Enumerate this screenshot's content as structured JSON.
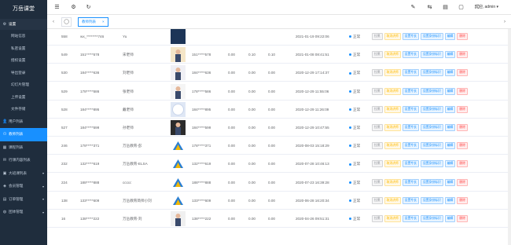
{
  "app": {
    "title": "万岳课堂"
  },
  "sidebar": {
    "settings_group": "设置",
    "settings_items": [
      "网站信息",
      "私密设置",
      "授权设置",
      "导出登录",
      "幻灯片管理",
      "上传设置",
      "文件存储"
    ],
    "menu_items": [
      {
        "label": "用户列表",
        "active": false
      },
      {
        "label": "教师列表",
        "active": true
      },
      {
        "label": "课程列表",
        "active": false
      },
      {
        "label": "行课内容列表",
        "active": false
      },
      {
        "label": "大班课列表",
        "active": false
      },
      {
        "label": "会员管理",
        "active": false
      },
      {
        "label": "订单管理",
        "active": false
      },
      {
        "label": "团体管理",
        "active": false
      }
    ]
  },
  "topbar": {
    "user_label": "欢迎, admin ▾"
  },
  "tabs": [
    {
      "label": "教师列表",
      "close": "×"
    }
  ],
  "tabs_nav": {
    "left_arrow": "‹",
    "right_arrow": "›",
    "home": "◯"
  },
  "table": {
    "rows": [
      {
        "id": "558",
        "mobile": "wx_********746",
        "name": "Yu",
        "account": "",
        "c1": "",
        "c2": "",
        "c3": "",
        "time": "2021-01-19 09:22:06",
        "status": "正常"
      },
      {
        "id": "549",
        "mobile": "151*****578",
        "name": "宋老师",
        "account": "151*****578",
        "c1": "0.00",
        "c2": "0.10",
        "c3": "0.10",
        "time": "2021-01-08 08:41:51",
        "status": "正常"
      },
      {
        "id": "530",
        "mobile": "184*****636",
        "name": "刘老师",
        "account": "184*****636",
        "c1": "0.00",
        "c2": "0.00",
        "c3": "0.00",
        "time": "2020-12-29 17:14:37",
        "status": "正常"
      },
      {
        "id": "529",
        "mobile": "178*****586",
        "name": "张老师",
        "account": "178*****586",
        "c1": "0.00",
        "c2": "0.00",
        "c3": "0.00",
        "time": "2020-12-29 11:55:06",
        "status": "正常"
      },
      {
        "id": "528",
        "mobile": "184*****895",
        "name": "戴老师",
        "account": "184*****895",
        "c1": "0.00",
        "c2": "0.00",
        "c3": "0.00",
        "time": "2020-12-29 11:26:09",
        "status": "正常"
      },
      {
        "id": "527",
        "mobile": "184*****599",
        "name": "孙老师",
        "account": "184*****599",
        "c1": "0.00",
        "c2": "0.00",
        "c3": "0.00",
        "time": "2020-12-29 10:47:55",
        "status": "正常"
      },
      {
        "id": "246",
        "mobile": "178*****371",
        "name": "万岳教育-彭",
        "account": "178*****371",
        "c1": "0.00",
        "c2": "0.00",
        "c3": "0.00",
        "time": "2020-08-03 15:18:29",
        "status": "正常"
      },
      {
        "id": "232",
        "mobile": "132*****619",
        "name": "万岳教育-ELSA",
        "account": "132*****619",
        "c1": "0.00",
        "c2": "0.00",
        "c3": "0.00",
        "time": "2020-07-28 10:46:13",
        "status": "正常"
      },
      {
        "id": "224",
        "mobile": "188*****888",
        "name": "ccccc",
        "account": "188*****888",
        "c1": "0.00",
        "c2": "0.00",
        "c3": "0.00",
        "time": "2020-07-23 16:39:28",
        "status": "正常"
      },
      {
        "id": "138",
        "mobile": "133*****609",
        "name": "万岳教育简师小刘",
        "account": "133*****609",
        "c1": "0.00",
        "c2": "0.00",
        "c3": "0.00",
        "time": "2020-06-28 16:20:34",
        "status": "正常"
      },
      {
        "id": "16",
        "mobile": "138*****222",
        "name": "万岳教育-刘",
        "account": "138*****222",
        "c1": "0.00",
        "c2": "0.00",
        "c3": "0.00",
        "time": "2020-04-26 09:51:31",
        "status": "正常"
      }
    ],
    "actions": [
      "拉黑",
      "取消讲师",
      "设置专长",
      "设置身份标识",
      "编辑",
      "删除"
    ]
  },
  "colors": {
    "sidebar_bg": "#1f2d3d",
    "accent": "#1890ff",
    "status": "#1890ff"
  }
}
